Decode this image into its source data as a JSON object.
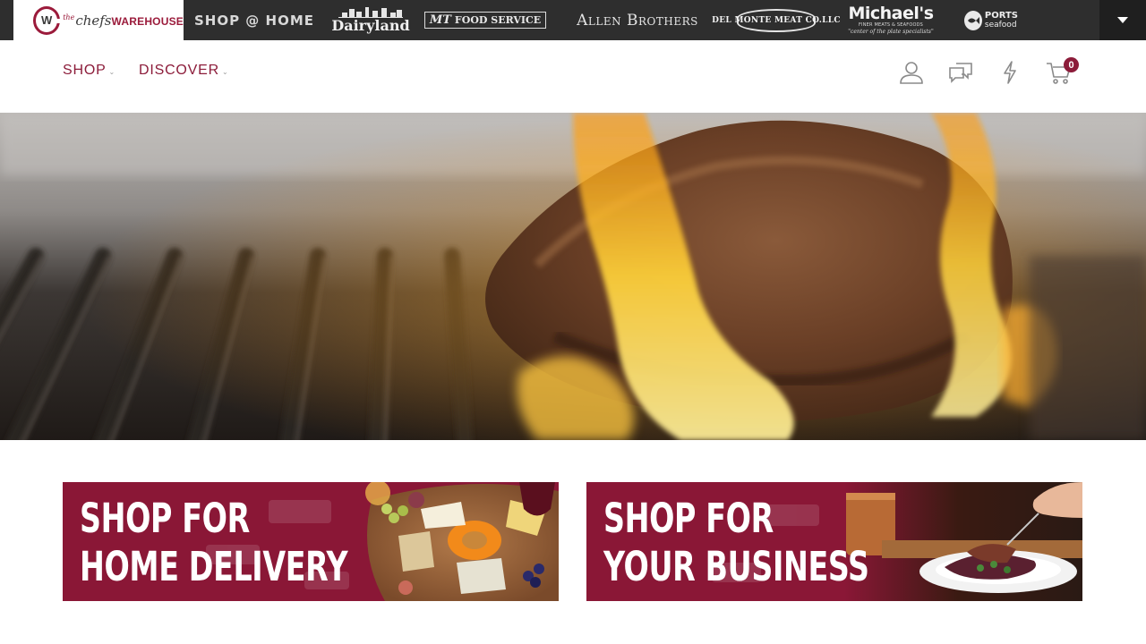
{
  "brand_strip": {
    "logo": {
      "the": "the",
      "chefs": "chefs",
      "warehouse": "WAREHOUSE",
      "monogram": "W"
    },
    "brands": {
      "shop_at_home": "SHOP @ HOME",
      "dairyland": "Dairyland",
      "mt_food_service": {
        "mark": "MT",
        "text": "FOOD SERVICE"
      },
      "allen_brothers": "Allen Brothers",
      "del_monte": "DEL MONTE MEAT CO.LLC",
      "michaels": {
        "name": "Michael's",
        "sub1": "FINER MEATS & SEAFOODS",
        "tagline": "\"center of the plate specialists\""
      },
      "ports": {
        "line1": "PORTS",
        "line2": "seafood"
      }
    },
    "toggle_icon": "caret-down-icon",
    "colors": {
      "strip_bg": "#2e2e2e",
      "toggle_bg": "#1f1f1f"
    }
  },
  "nav": {
    "shop_label": "SHOP",
    "discover_label": "DISCOVER",
    "accent": "#8c1c3a",
    "icons": [
      "account-icon",
      "chat-icon",
      "lightning-icon",
      "cart-icon"
    ],
    "cart_count": "0"
  },
  "promos": {
    "home": {
      "line1": "SHOP FOR",
      "line2": "HOME DELIVERY"
    },
    "business": {
      "line1": "SHOP FOR",
      "line2": "YOUR BUSINESS"
    },
    "color": "#8a1736"
  }
}
